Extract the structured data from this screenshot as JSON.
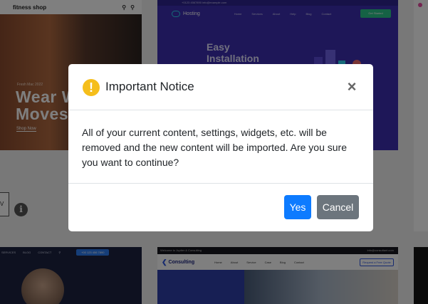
{
  "background": {
    "fitness_card": {
      "brand": "fitness shop",
      "hero_subtitle": "Fresh Mac 2022",
      "hero_title_line1": "Wear W",
      "hero_title_line2": "Moves Y",
      "hero_link": "Shop Now"
    },
    "hosting_card": {
      "topbar": "+0123 4567890   info@example.com",
      "logo": "Hosting",
      "nav_links": [
        "Home",
        "Services",
        "About",
        "Help",
        "Blog",
        "Contact"
      ],
      "cta": "Get Started",
      "hero_line1": "Easy",
      "hero_line2": "Installation"
    },
    "left_mid_label": "V",
    "info_icon_glyph": "i",
    "bottom_left_card": {
      "nav_links": [
        "SERVICES",
        "BLOG",
        "CONTACT"
      ],
      "button": "+00 123 456 7890"
    },
    "consulting_card": {
      "topbar_left": "Welcome to Jupiter & Consulting",
      "topbar_right": "info@consultant.com",
      "logo": "Consulting",
      "nav_links": [
        "Home",
        "About",
        "Service",
        "Case",
        "Blog",
        "Contact"
      ],
      "button": "Request a Free Quote"
    }
  },
  "modal": {
    "title": "Important Notice",
    "warning_glyph": "!",
    "close_glyph": "×",
    "body": "All of your current content, settings, widgets, etc. will be removed and the new content will be imported. Are you sure you want to continue?",
    "yes_label": "Yes",
    "cancel_label": "Cancel"
  },
  "colors": {
    "primary": "#0d7bff",
    "secondary": "#6c757d",
    "warning": "#f5be1b"
  }
}
